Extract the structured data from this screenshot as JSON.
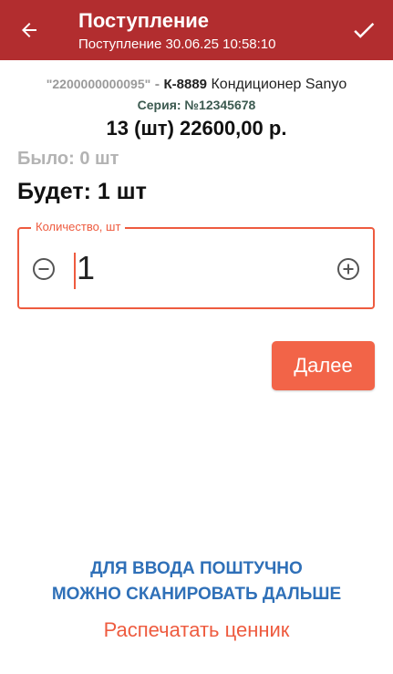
{
  "app_bar": {
    "title": "Поступление",
    "subtitle": "Поступление 30.06.25 10:58:10",
    "color": "#b22d2f",
    "back_icon": "arrow-left-icon",
    "confirm_icon": "check-icon"
  },
  "product": {
    "barcode": "\"2200000000095\"",
    "separator": "-",
    "article": "К-8889",
    "name": "Кондиционер Sanyo",
    "series": "Серия: №12345678",
    "price_line": "13 (шт) 22600,00 р."
  },
  "counts": {
    "was": "Было: 0 шт",
    "will": "Будет: 1 шт"
  },
  "quantity_field": {
    "label": "Количество, шт",
    "value": "1",
    "accent": "#ee5b3f",
    "minus_icon": "minus-circle-icon",
    "plus_icon": "plus-circle-icon"
  },
  "actions": {
    "next_label": "Далее",
    "next_color": "#f26448"
  },
  "footer": {
    "hint_line1": "ДЛЯ ВВОДА ПОШТУЧНО",
    "hint_line2": "МОЖНО СКАНИРОВАТЬ ДАЛЬШЕ",
    "print_label": "Распечатать ценник",
    "hint_color": "#2f70b8"
  }
}
